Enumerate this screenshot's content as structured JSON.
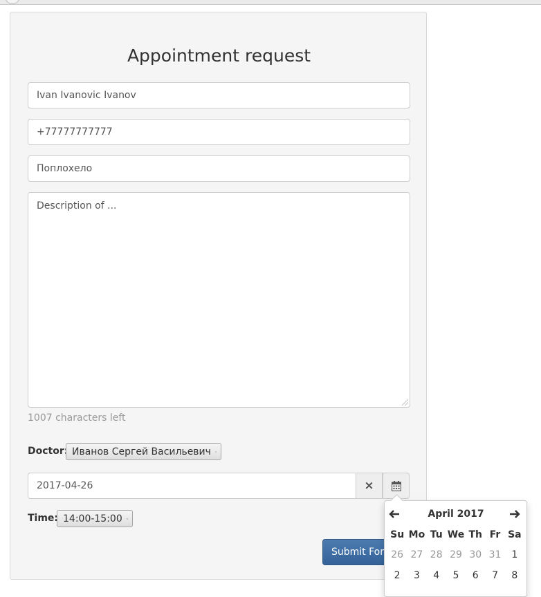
{
  "form": {
    "title": "Appointment request",
    "name_value": "Ivan Ivanovic Ivanov",
    "phone_value": "+77777777777",
    "complaint_value": "Поплохело",
    "description_placeholder": "Description of ...",
    "chars_left": "1007 characters left",
    "doctor_label": "Doctor:",
    "doctor_selected": "Иванов Сергей Васильевич",
    "date_value": "2017-04-26",
    "time_label": "Time:",
    "time_selected": "14:00-15:00",
    "submit_label": "Submit Form"
  },
  "icons": {
    "clear": "×",
    "calendar": "calendar-icon",
    "chevron": "⌄",
    "prev": "🡐",
    "next": "🡒"
  },
  "datepicker": {
    "month_label": "April 2017",
    "prev_arrow": "←",
    "next_arrow": "→",
    "weekdays": [
      "Su",
      "Mo",
      "Tu",
      "We",
      "Th",
      "Fr",
      "Sa"
    ],
    "week1": [
      "26",
      "27",
      "28",
      "29",
      "30",
      "31",
      "1"
    ],
    "week2": [
      "2",
      "3",
      "4",
      "5",
      "6",
      "7",
      "8"
    ]
  }
}
